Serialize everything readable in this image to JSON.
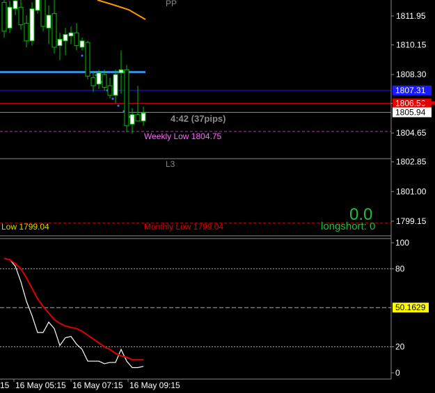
{
  "chart_data": [
    {
      "type": "candlestick",
      "pane": "price",
      "ylim": [
        1798.5,
        1813.5
      ],
      "price_ticks": [
        "1811.95",
        "1810.15",
        "1808.30",
        "1806.50",
        "1804.65",
        "1802.85",
        "1801.00",
        "1799.15"
      ],
      "price_tick_values": [
        1811.95,
        1810.15,
        1808.3,
        1806.5,
        1804.65,
        1802.85,
        1801.0,
        1799.15
      ],
      "candles": [
        {
          "o": 1812.8,
          "h": 1813.6,
          "l": 1810.6,
          "c": 1811.0
        },
        {
          "o": 1811.2,
          "h": 1812.9,
          "l": 1810.9,
          "c": 1812.5
        },
        {
          "o": 1812.4,
          "h": 1813.3,
          "l": 1812.0,
          "c": 1812.9
        },
        {
          "o": 1812.5,
          "h": 1813.0,
          "l": 1811.1,
          "c": 1811.4
        },
        {
          "o": 1811.5,
          "h": 1812.0,
          "l": 1810.0,
          "c": 1810.4
        },
        {
          "o": 1810.4,
          "h": 1812.8,
          "l": 1810.1,
          "c": 1812.4
        },
        {
          "o": 1812.3,
          "h": 1813.4,
          "l": 1812.1,
          "c": 1813.2
        },
        {
          "o": 1813.1,
          "h": 1813.5,
          "l": 1811.0,
          "c": 1811.3
        },
        {
          "o": 1811.2,
          "h": 1812.6,
          "l": 1810.2,
          "c": 1812.0
        },
        {
          "o": 1812.1,
          "h": 1813.6,
          "l": 1809.6,
          "c": 1810.0
        },
        {
          "o": 1810.1,
          "h": 1810.9,
          "l": 1809.2,
          "c": 1810.5
        },
        {
          "o": 1810.4,
          "h": 1811.2,
          "l": 1809.5,
          "c": 1810.8
        },
        {
          "o": 1810.7,
          "h": 1811.3,
          "l": 1810.2,
          "c": 1810.9
        },
        {
          "o": 1810.9,
          "h": 1811.5,
          "l": 1809.8,
          "c": 1810.1
        },
        {
          "o": 1810.0,
          "h": 1810.6,
          "l": 1809.8,
          "c": 1810.4
        },
        {
          "o": 1810.3,
          "h": 1810.4,
          "l": 1808.0,
          "c": 1808.2
        },
        {
          "o": 1808.1,
          "h": 1808.5,
          "l": 1807.2,
          "c": 1807.6
        },
        {
          "o": 1807.7,
          "h": 1808.6,
          "l": 1807.4,
          "c": 1808.4
        },
        {
          "o": 1808.3,
          "h": 1808.6,
          "l": 1807.3,
          "c": 1807.5
        },
        {
          "o": 1807.6,
          "h": 1808.1,
          "l": 1806.8,
          "c": 1807.0
        },
        {
          "o": 1807.0,
          "h": 1808.6,
          "l": 1806.5,
          "c": 1808.3
        },
        {
          "o": 1808.4,
          "h": 1809.8,
          "l": 1807.1,
          "c": 1808.6
        },
        {
          "o": 1808.6,
          "h": 1808.9,
          "l": 1804.7,
          "c": 1805.1
        },
        {
          "o": 1805.2,
          "h": 1806.2,
          "l": 1804.6,
          "c": 1805.8
        },
        {
          "o": 1805.8,
          "h": 1807.6,
          "l": 1805.4,
          "c": 1805.4
        },
        {
          "o": 1805.4,
          "h": 1806.3,
          "l": 1805.1,
          "c": 1805.9
        }
      ],
      "horizontal_levels": [
        {
          "value": 1808.45,
          "color": "#3a8ee6",
          "style": "solid",
          "width": 3,
          "extent": "partial"
        },
        {
          "value": 1807.31,
          "color": "#1a1aff",
          "style": "solid",
          "width": 1,
          "extent": "full"
        },
        {
          "value": 1806.5,
          "color": "#d60000",
          "style": "solid",
          "width": 1,
          "extent": "full"
        },
        {
          "value": 1805.94,
          "color": "#888888",
          "style": "solid",
          "width": 1,
          "extent": "full"
        },
        {
          "value": 1804.75,
          "color": "#c030c0",
          "style": "dashed",
          "width": 1,
          "extent": "full"
        },
        {
          "value": 1803.05,
          "color": "#8a8a8a",
          "style": "solid",
          "width": 1,
          "extent": "full"
        },
        {
          "value": 1799.04,
          "color": "#a00000",
          "style": "dashed",
          "width": 1,
          "extent": "full"
        }
      ]
    },
    {
      "type": "line",
      "pane": "oscillator",
      "ylim": [
        0,
        100
      ],
      "osc_ticks": [
        "100",
        "80",
        "20",
        "0"
      ],
      "osc_tick_values": [
        100,
        80,
        20,
        0
      ],
      "levels": [
        80,
        50.1629,
        20
      ],
      "series": [
        {
          "color": "#ffffff",
          "values": [
            88,
            87,
            82,
            70,
            55,
            44,
            31,
            31,
            39,
            34,
            21,
            27,
            28,
            22,
            18,
            9,
            9,
            9,
            7,
            8,
            8,
            18,
            9,
            4,
            4,
            5
          ]
        },
        {
          "color": "#e00000",
          "values": [
            88,
            87,
            84,
            80,
            73,
            65,
            57,
            51,
            46,
            41,
            38,
            36,
            35,
            34,
            32,
            29,
            26,
            23,
            20,
            18,
            15,
            13,
            12,
            10,
            10,
            10
          ]
        }
      ]
    }
  ],
  "price_axis": {
    "tags": [
      {
        "label": "1807.31",
        "value": 1807.31,
        "bg": "#1a1aff",
        "fg": "#ffffff"
      },
      {
        "label": "1806.50",
        "value": 1806.5,
        "bg": "#e00000",
        "fg": "#ffffff"
      },
      {
        "label": "1805.94",
        "value": 1805.94,
        "bg": "#ffffff",
        "fg": "#000000"
      }
    ]
  },
  "osc_axis": {
    "tag": {
      "label": "50.1629",
      "value": 50.1629,
      "bg": "#ffff00",
      "fg": "#000000"
    }
  },
  "labels": {
    "pp": "PP",
    "l3": "L3",
    "timer": "4:42 (37pips)",
    "weekly_low": "Weekly Low 1804.75",
    "monthly_low": "Monthly Low 1799.04",
    "low_left": "Low 1799.04",
    "big_zero": "0.0",
    "longshort": "longshort: 0"
  },
  "time_axis": [
    "15",
    "16 May 05:15",
    "16 May 07:15",
    "16 May 09:15"
  ],
  "colors": {
    "bull": "#ffffff",
    "bear": "#000000",
    "wick": "#00c000",
    "grid": "#5a5a5a",
    "ma": "#ff9900",
    "green_text": "#1fbf3a",
    "dots": "#3a6bff"
  }
}
